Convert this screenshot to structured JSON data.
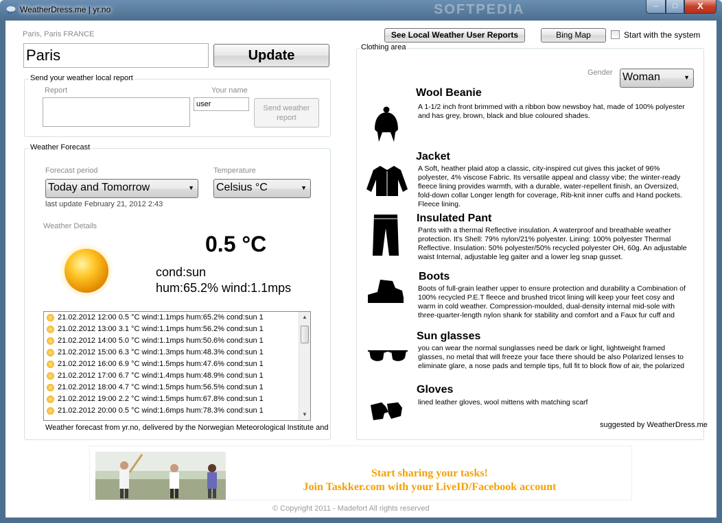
{
  "window": {
    "title": "WeatherDress.me | yr.no",
    "watermark": "SOFTPEDIA",
    "min_label": "–",
    "max_label": "□",
    "close_label": "X"
  },
  "location": {
    "caption": "Paris,  Paris FRANCE",
    "city_value": "Paris",
    "update_label": "Update"
  },
  "report": {
    "group_label": "Send your weather local report",
    "report_label": "Report",
    "report_value": "",
    "name_label": "Your name",
    "name_value": "user",
    "send_label": "Send  weather report"
  },
  "forecast": {
    "group_label": "Weather Forecast",
    "period_label": "Forecast period",
    "period_value": "Today and Tomorrow",
    "temp_label": "Temperature",
    "temp_value": "Celsius °C",
    "last_update": "last update February 21, 2012 2:43",
    "details_label": "Weather Details",
    "temperature": "0.5 °C",
    "cond": "cond:sun",
    "hum_wind": "hum:65.2% wind:1.1mps",
    "rows": [
      "21.02.2012 12:00 0.5 °C wind:1.1mps hum:65.2% cond:sun 1",
      "21.02.2012 13:00 3.1 °C wind:1.1mps hum:56.2% cond:sun 1",
      "21.02.2012 14:00 5.0 °C wind:1.1mps hum:50.6% cond:sun 1",
      "21.02.2012 15:00 6.3 °C wind:1.3mps hum:48.3% cond:sun 1",
      "21.02.2012 16:00 6.9 °C wind:1.5mps hum:47.6% cond:sun 1",
      "21.02.2012 17:00 6.7 °C wind:1.4mps hum:48.9% cond:sun 1",
      "21.02.2012 18:00 4.7 °C wind:1.5mps hum:56.5% cond:sun 1",
      "21.02.2012 19:00 2.2 °C wind:1.5mps hum:67.8% cond:sun 1",
      "21.02.2012 20:00 0.5 °C wind:1.6mps hum:78.3% cond:sun 1"
    ],
    "footer": "Weather forecast from yr.no, delivered by the Norwegian Meteorological Institute and the"
  },
  "top_buttons": {
    "reports_label": "See Local Weather User Reports",
    "bing_label": "Bing Map",
    "startup_label": "Start with the system",
    "startup_checked": false
  },
  "clothing": {
    "group_label": "Clothing area",
    "gender_label": "Gender",
    "gender_value": "Woman",
    "items": [
      {
        "title": "Wool Beanie",
        "icon": "beanie-icon",
        "desc": "A 1-1/2 inch front brimmed with a ribbon bow newsboy hat, made of 100% polyester and has grey, brown, black and blue coloured shades."
      },
      {
        "title": "Jacket",
        "icon": "jacket-icon",
        "desc": "A Soft, heather plaid atop a classic, city-inspired cut gives this jacket of 96% polyester, 4% viscose Fabric. Its versatile appeal and classy vibe; the winter-ready fleece lining provides warmth, with a durable, water-repellent finish, an Oversized, fold-down collar Longer length for coverage, Rib-knit inner cuffs and Hand pockets. Fleece lining."
      },
      {
        "title": "Insulated Pant",
        "icon": "pants-icon",
        "desc": "Pants with a thermal Reflective insulation. A waterproof and breathable weather protection. It's Shell: 79% nylon/21% polyester. Lining: 100% polyester Thermal Reflective. Insulation: 50% polyester/50% recycled polyester OH, 60g. An adjustable waist Internal, adjustable leg gaiter and a lower leg snap gusset."
      },
      {
        "title": "Boots",
        "icon": "boot-icon",
        "desc": "Boots of full-grain leather upper to ensure protection and durability a Combination of 100% recycled P.E.T fleece and brushed tricot lining will keep your feet cosy and warm in cold weather. Compression-moulded, dual-density internal mid-sole with three-quarter-length nylon shank for stability and comfort and a Faux fur cuff and"
      },
      {
        "title": "Sun glasses",
        "icon": "sunglasses-icon",
        "desc": "you can wear  the normal sunglasses need be dark or light, lightweight framed glasses, no metal that will freeze your face there should be also Polarized lenses to eliminate glare, a nose pads and temple tips, full fit to block flow of air, the polarized"
      },
      {
        "title": "Gloves",
        "icon": "gloves-icon",
        "desc": "lined leather gloves, wool mittens with matching scarf"
      }
    ],
    "suggested_by": "suggested by WeatherDress.me"
  },
  "ad": {
    "line1": "Start sharing your tasks!",
    "line2": "Join Taskker.com with your LiveID/Facebook account",
    "color": "#f5a000"
  },
  "copyright": "© Copyright 2011 - Madefort All rights reserved"
}
